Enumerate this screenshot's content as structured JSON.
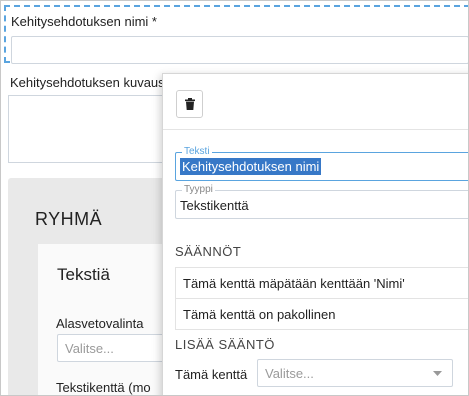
{
  "form": {
    "name_label": "Kehitysehdotuksen nimi *",
    "description_label": "Kehitysehdotuksen kuvaus",
    "group_title": "RYHMÄ",
    "inner_title": "Tekstiä",
    "dropdown_label": "Alasvetovalinta",
    "dropdown_placeholder": "Valitse...",
    "textfield_label": "Tekstikenttä (mo"
  },
  "popover": {
    "delete_icon": "trash-icon",
    "text_legend": "Teksti",
    "text_value": "Kehitysehdotuksen nimi",
    "type_legend": "Tyyppi",
    "type_value": "Tekstikenttä",
    "rules_heading": "SÄÄNNÖT",
    "rules": [
      "Tämä kenttä mäpätään kenttään 'Nimi'",
      "Tämä kenttä on pakollinen"
    ],
    "add_rule_heading": "LISÄÄ SÄÄNTÖ",
    "add_rule_label": "Tämä kenttä",
    "add_rule_placeholder": "Valitse..."
  },
  "colors": {
    "accent": "#5aa4df",
    "selection": "#3778c7",
    "panel_gray": "#e9e9e9"
  }
}
